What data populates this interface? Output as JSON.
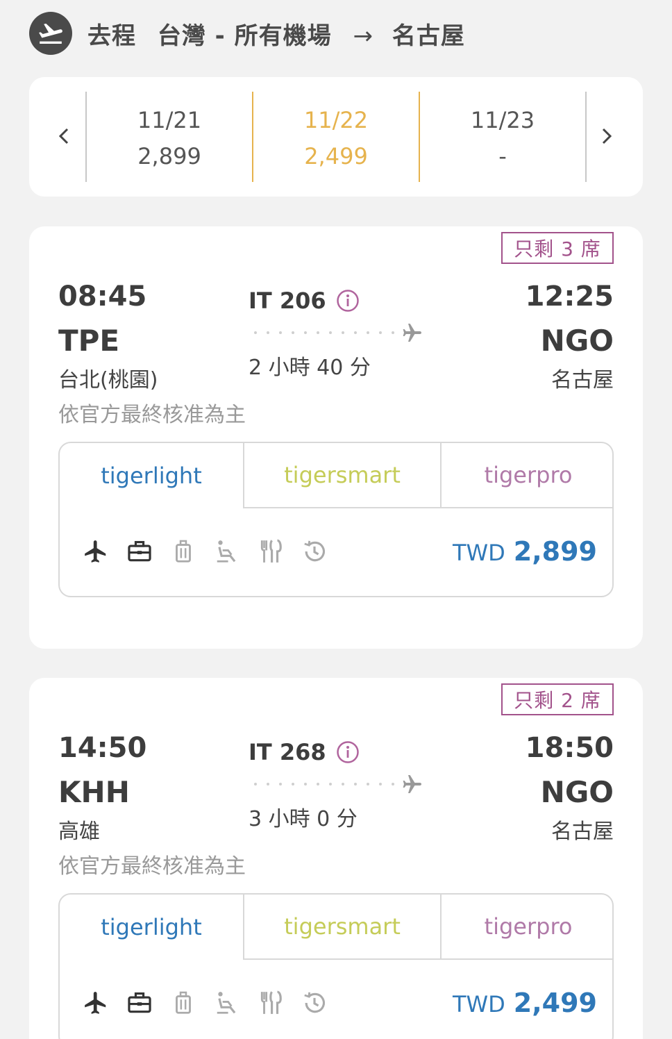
{
  "header": {
    "direction": "去程",
    "origin": "台灣 - 所有機場",
    "arrow": "→",
    "destination": "名古屋"
  },
  "dates": [
    {
      "date": "11/21",
      "price": "2,899",
      "selected": false
    },
    {
      "date": "11/22",
      "price": "2,499",
      "selected": true
    },
    {
      "date": "11/23",
      "price": "-",
      "selected": false
    }
  ],
  "flights": [
    {
      "seats_left": "只剩 3 席",
      "dep_time": "08:45",
      "dep_code": "TPE",
      "dep_city": "台北(桃園)",
      "note": "依官方最終核准為主",
      "flight_no": "IT 206",
      "duration": "2 小時 40 分",
      "arr_time": "12:25",
      "arr_code": "NGO",
      "arr_city": "名古屋",
      "fares": [
        "tigerlight",
        "tigersmart",
        "tigerpro"
      ],
      "currency": "TWD",
      "price": "2,899"
    },
    {
      "seats_left": "只剩 2 席",
      "dep_time": "14:50",
      "dep_code": "KHH",
      "dep_city": "高雄",
      "note": "依官方最終核准為主",
      "flight_no": "IT 268",
      "duration": "3 小時 0 分",
      "arr_time": "18:50",
      "arr_code": "NGO",
      "arr_city": "名古屋",
      "fares": [
        "tigerlight",
        "tigersmart",
        "tigerpro"
      ],
      "currency": "TWD",
      "price": "2,499"
    }
  ],
  "feature_icons": [
    "plane-icon",
    "briefcase-icon",
    "luggage-icon",
    "seat-icon",
    "meal-icon",
    "history-icon"
  ],
  "colors": {
    "accent_selected": "#e6b34d",
    "tigerlight": "#2f78b8",
    "tigersmart": "#c5cc58",
    "tigerpro": "#b07aa8",
    "seats_badge": "#a2528b"
  }
}
